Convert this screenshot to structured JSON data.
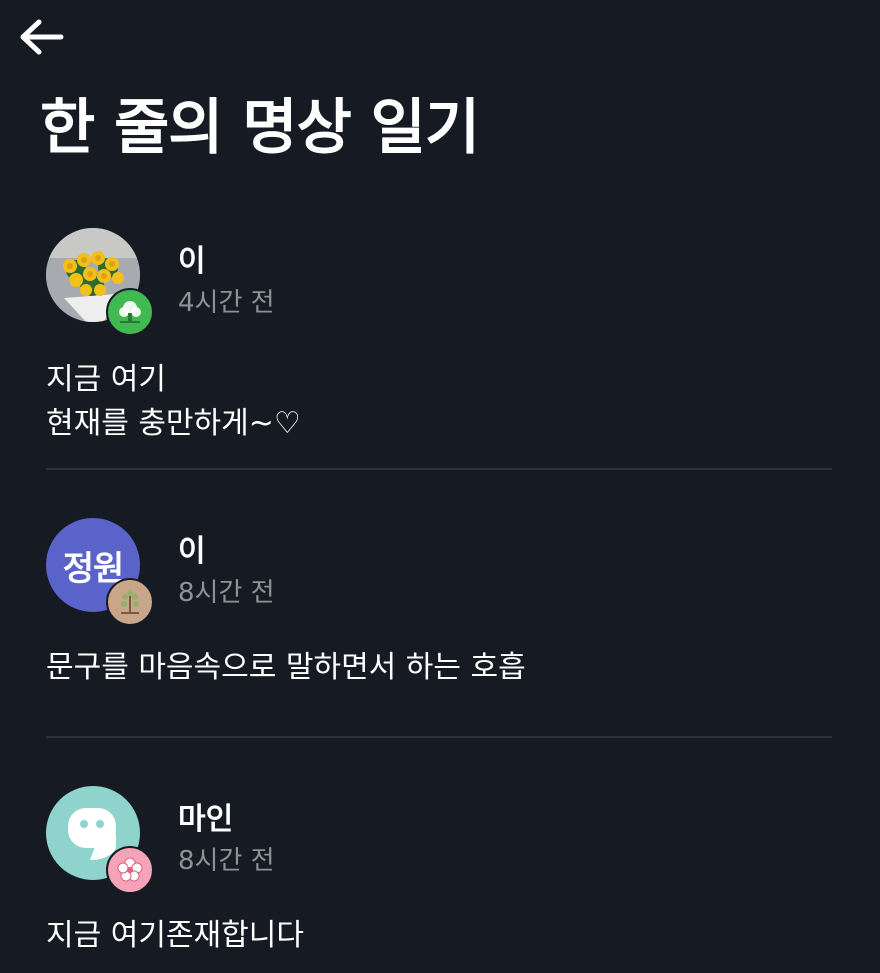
{
  "header": {
    "back_icon": "arrow-left-icon",
    "title": "한 줄의 명상 일기"
  },
  "posts": [
    {
      "author": "이",
      "time": "4시간 전",
      "avatar": {
        "type": "photo",
        "description_icon": "yellow-roses-photo",
        "bg": "#9aa0a6"
      },
      "badge": {
        "icon": "tree-icon",
        "bg": "#3fb950"
      },
      "body_lines": [
        "지금 여기",
        "현재를 충만하게~♡"
      ]
    },
    {
      "author": "이",
      "time": "8시간 전",
      "avatar": {
        "type": "initials",
        "initials": "정원",
        "bg": "#5a63c9"
      },
      "badge": {
        "icon": "sapling-icon",
        "bg": "#c9a58a"
      },
      "body_lines": [
        "문구를 마음속으로 말하면서 하는 호흡"
      ]
    },
    {
      "author": "마인",
      "time": "8시간 전",
      "avatar": {
        "type": "logo",
        "logo_icon": "face-9-icon",
        "bg": "#8fd3cd"
      },
      "badge": {
        "icon": "flower-icon",
        "bg": "#f4a3b8"
      },
      "body_lines": [
        "지금 여기존재합니다"
      ]
    }
  ]
}
